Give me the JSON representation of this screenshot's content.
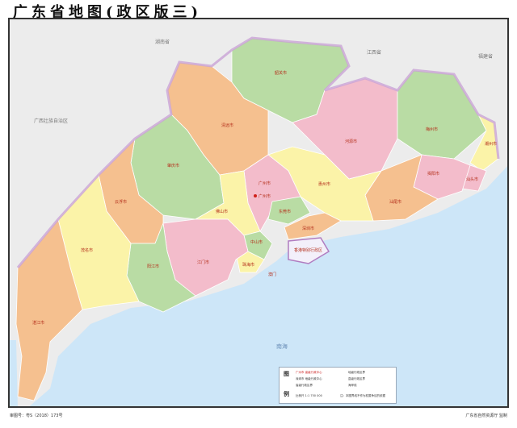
{
  "title": "广东省地图(政区版三)",
  "approval_number": "审图号：粤S（2018）173号",
  "producer": "广东省自然资源厅  监制",
  "colors": {
    "orange": "#f5c08f",
    "green": "#b9dca4",
    "pink": "#f3bccb",
    "yellow": "#fbf3a8",
    "sea": "#cde6f8",
    "land_outside": "#ececec",
    "border": "#b07cc0"
  },
  "neighbors": [
    "湖南省",
    "江西省",
    "福建省",
    "广西壮族自治区"
  ],
  "sea_label": "南海",
  "cities": [
    "韶关市",
    "清远市",
    "肇庆市",
    "河源市",
    "梅州市",
    "潮州市",
    "汕头市",
    "揭阳市",
    "汕尾市",
    "惠州市",
    "广州市",
    "东莞市",
    "深圳市",
    "香港特别行政区",
    "佛山市",
    "中山市",
    "珠海市",
    "澳门",
    "江门市",
    "云浮市",
    "阳江市",
    "茂名市",
    "湛江市"
  ],
  "capital": "广州市",
  "legend": {
    "heading_1": "图",
    "heading_2": "例",
    "items": [
      "广州市 省级行政中心",
      "深圳市 地级行政中心",
      "省级行政区界",
      "地级行政区界",
      "县级行政区界",
      "海岸线"
    ],
    "scale": "比例尺 1:1 750 000",
    "note": "注：本图界线不作为权属争议的依据"
  }
}
